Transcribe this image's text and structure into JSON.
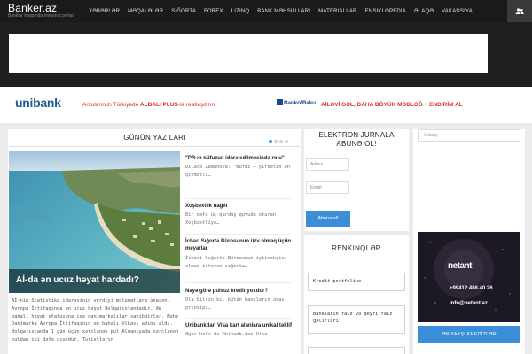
{
  "site": {
    "title": "Banker.az",
    "tagline": "Banklar haqqında məlumat portalı"
  },
  "nav": {
    "items": [
      "XƏBƏRLƏR",
      "MƏQALƏLƏR",
      "SIĞORTA",
      "FOREX",
      "LIZINQ",
      "BANK MƏHSULLARI",
      "MATERIALLAR",
      "ENSIKLOPEDIA",
      "ƏLAQƏ",
      "VAKANSIYA"
    ]
  },
  "banners": {
    "unibank_logo": "unibank",
    "unibank_text_prefix": "Arzularınızı Türkiyədə",
    "unibank_text_bold": "ALBALI PLUS",
    "unibank_text_suffix": "-la reallaşdırın",
    "bob_logo": "BankofBaku",
    "bob_text": "AİLƏVİ GƏL, DAHA BÖYÜK MƏBLƏĞ + ENDİRİM AL"
  },
  "gunun": {
    "title": "GÜNÜN YAZILARI",
    "hero_caption": "Aİ-da ən ucuz həyat hardadı?",
    "hero_excerpt": "Aİ-nin Statistika idarəsinin verdiyi məlumatlara əsasən, Avropa İttifaqında ən ucuz həyat Bolqarıstandadır. Ən bahalı həyat statusuna isə danimarkalılar sahibdirlər. Məhz Danimarka Avropa İttifaqının ən bahalı ölkəsi adını aldı. Bolqarıstanda 1 gün üçün xərclənən pul Almaniyada xərclənən puldan iki dəfə ucuzdur. Turistlərin",
    "articles": [
      {
        "title": "\"PR-ın nüfuzun idarə edilməsində rolu\"",
        "text": "Dilarə Zamanova: \"Nüfuz – şirkətin ən qiymətli…"
      },
      {
        "title": "Xoşbəxtlik nağılı",
        "text": "Bir dəfə üç qardaş quyuda oturan Xoşbəxtliyə…"
      },
      {
        "title": "İcbari Sığorta Bürosunun üzv olmaq üçün meyarlar",
        "text": "İcbari Sığorta Bürosunun iştirakçısı olmaq istəyən sığorta…"
      },
      {
        "title": "Nəyə görə pulsuz kredit yoxdur?",
        "text": "Ola bilsin ki, bütün bankların əsas prinsipi…"
      },
      {
        "title": "Unibankdan Visa kart alanlara unikal təklif",
        "text": "Əgər hələ də Unibank-dan Visa"
      }
    ]
  },
  "subscribe": {
    "title_line1": "ELEKTRON JURNALA",
    "title_line2": "ABUNƏ OL!",
    "name_placeholder": "Adınız",
    "email_placeholder": "Email",
    "button_label": "Abunə ol!"
  },
  "renk": {
    "title": "RENKINQLƏR",
    "cards": [
      "Kredit portfelinə",
      "Bankların faiz və qeyri faiz gəlirləri",
      ""
    ]
  },
  "right": {
    "search_placeholder": "Axtarış",
    "netant_brand": "netant",
    "netant_phone": "+99412 408 40 26",
    "netant_mail": "info@netant.az",
    "kredit_button": "ƏN YAXŞI KREDİTLƏR"
  },
  "colors": {
    "topbar": "#1a1a1a",
    "accent_blue": "#3a8fd8",
    "promo_red": "#d63030",
    "unibank_blue": "#1d5a94"
  }
}
